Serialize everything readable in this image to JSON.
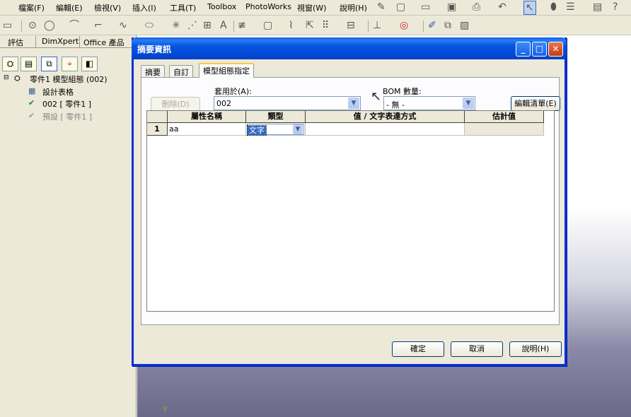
{
  "menu": {
    "items": [
      "檔案(F)",
      "編輯(E)",
      "檢視(V)",
      "插入(I)",
      "工具(T)",
      "Toolbox",
      "PhotoWorks",
      "視窗(W)",
      "說明(H)"
    ]
  },
  "left_panel": {
    "tabs": [
      "評估",
      "DimXpert",
      "Office 產品"
    ],
    "tree": {
      "root": "零件1 模型組態  (002)",
      "children": [
        "設計表格",
        "002 [ 零件1 ]",
        "預設 [ 零件1 ]"
      ]
    }
  },
  "dialog": {
    "title": "摘要資訊",
    "tabs": [
      "摘要",
      "自訂",
      "模型組態指定"
    ],
    "delete_button": "刪除(D)",
    "apply_to_label": "套用於(A):",
    "apply_to_value": "002",
    "bom_label": "BOM 數量:",
    "bom_value": "- 無 -",
    "edit_list_button": "編輯清單(E)",
    "grid": {
      "headers": [
        "屬性名稱",
        "類型",
        "值 / 文字表達方式",
        "估計值"
      ],
      "rows": [
        {
          "num": "1",
          "name": "aa",
          "type": "文字",
          "value": "",
          "estimated": ""
        }
      ]
    },
    "ok_button": "確定",
    "cancel_button": "取消",
    "help_button": "說明(H)"
  },
  "colors": {
    "title_bar": "#0454e0",
    "dialog_bg": "#ece9d8",
    "selection": "#316ac5"
  }
}
